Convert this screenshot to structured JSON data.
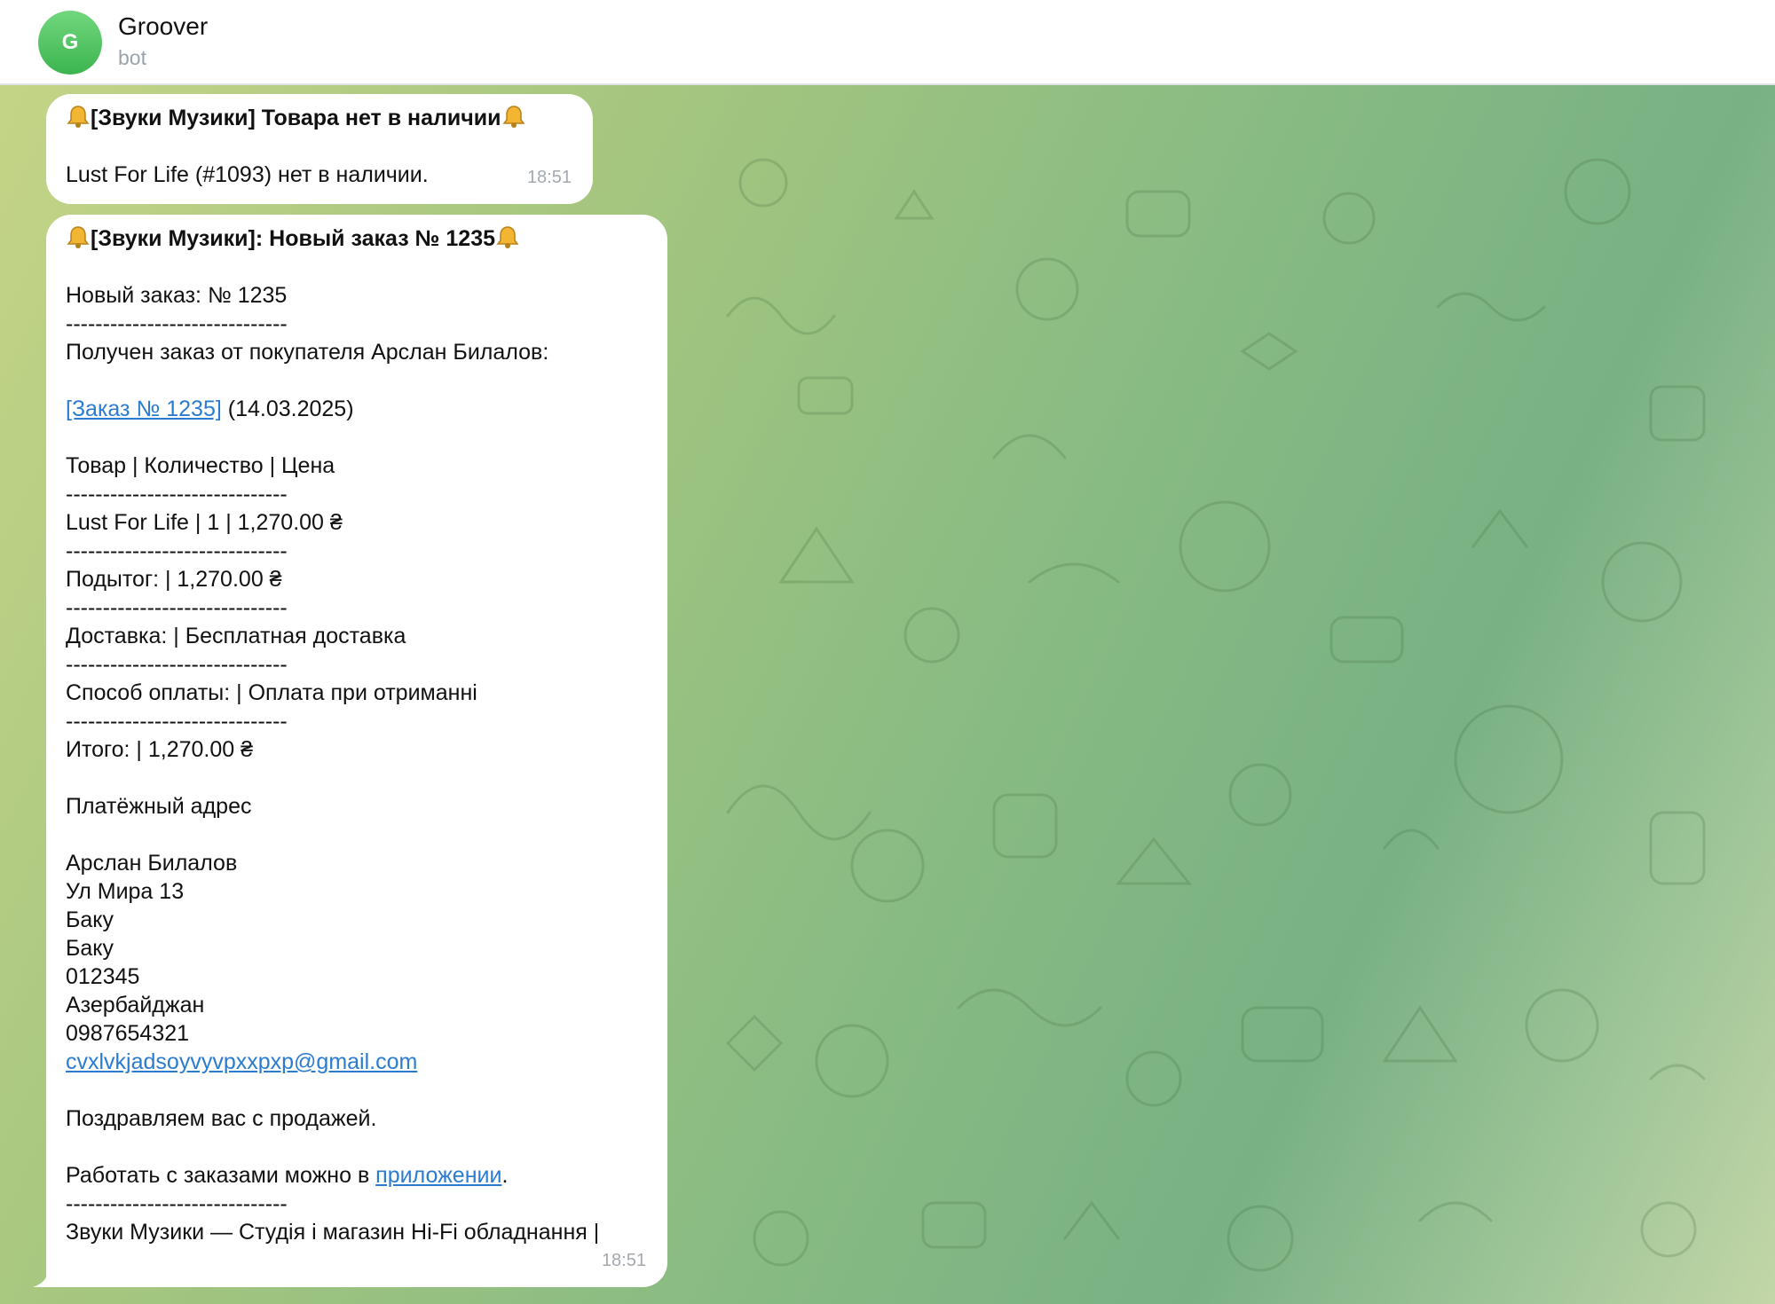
{
  "header": {
    "avatar_letter": "G",
    "title": "Groover",
    "subtitle": "bot"
  },
  "colors": {
    "avatar": "#4cc45d",
    "link": "#2a7cd1",
    "bubble": "#ffffff",
    "timestamp": "#a3a9ae"
  },
  "messages": [
    {
      "title": "[Звуки Музики] Товара нет в наличии",
      "text": "Lust For Life (#1093) нет в наличии.",
      "time": "18:51"
    },
    {
      "title": "[Звуки Музики]: Новый заказ № 1235",
      "new_order": "Новый заказ: № 1235",
      "separator": "------------------------------",
      "received_from": "Получен заказ от покупателя Арслан Билалов:",
      "order_link": "[Заказ № 1235]",
      "order_date": "(14.03.2025)",
      "table_header": "Товар | Количество | Цена",
      "item_line": "Lust For Life | 1 | 1,270.00 ₴",
      "subtotal": "Подытог: | 1,270.00 ₴",
      "shipping": "Доставка: | Бесплатная доставка",
      "payment": "Способ оплаты: | Оплата при отриманні",
      "total": "Итого: | 1,270.00 ₴",
      "billing_title": "Платёжный адрес",
      "address": {
        "name": "Арслан Билалов",
        "street": "Ул Мира 13",
        "city": "Баку",
        "state": "Баку",
        "postcode": "012345",
        "country": "Азербайджан",
        "phone": "0987654321",
        "email": "cvxlvkjadsoyvyvpxxpxp@gmail.com"
      },
      "congrats": "Поздравляем вас с продажей.",
      "work_prefix": "Работать с заказами можно в ",
      "work_link": "приложении",
      "work_suffix": ".",
      "footer": "Звуки Музики — Студія і магазин Hi-Fi обладнання |",
      "time": "18:51"
    }
  ]
}
